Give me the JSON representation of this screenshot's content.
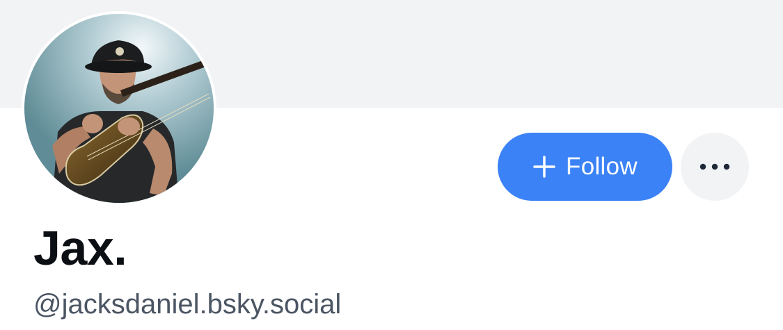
{
  "profile": {
    "display_name": "Jax.",
    "handle": "@jacksdaniel.bsky.social",
    "avatar": "avatar-photo-musician-with-bass-guitar"
  },
  "actions": {
    "follow_label": "Follow",
    "follow_icon": "plus-icon",
    "more_icon": "ellipsis-icon"
  },
  "colors": {
    "banner": "#f1f3f5",
    "follow_button": "#3b82f6",
    "more_button": "#f1f3f5",
    "name_text": "#0b0f14",
    "handle_text": "#4b5563"
  }
}
